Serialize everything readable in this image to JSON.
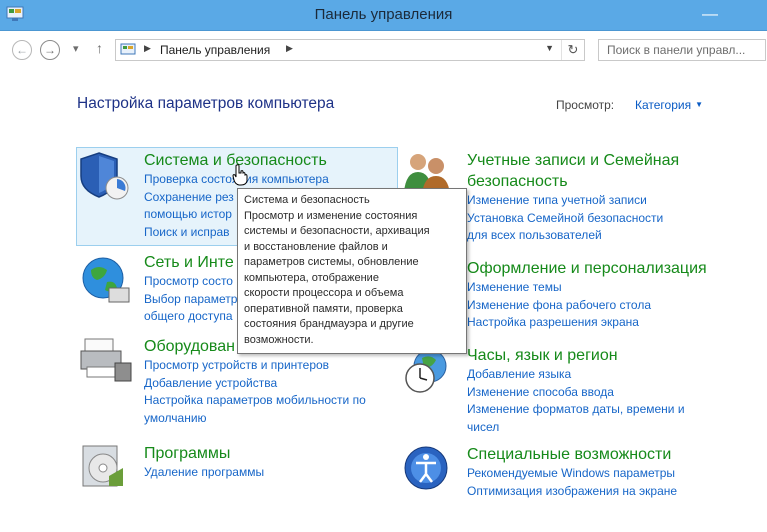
{
  "window": {
    "title": "Панель управления",
    "minimize": "—"
  },
  "nav": {
    "back": "←",
    "forward": "→",
    "recent": "▾",
    "up": "↑",
    "breadcrumb": "Панель управления",
    "search_placeholder": "Поиск в панели управл..."
  },
  "heading": "Настройка параметров компьютера",
  "view": {
    "label": "Просмотр:",
    "value": "Категория"
  },
  "categories": [
    {
      "title": "Система и безопасность",
      "links": [
        "Проверка состояния компьютера",
        "Сохранение рез",
        "помощью истор",
        "Поиск и исправ"
      ]
    },
    {
      "title": "Сеть и Инте",
      "links": [
        "Просмотр состо",
        "Выбор параметр",
        "общего доступа"
      ]
    },
    {
      "title": "Оборудован",
      "links": [
        "Просмотр устройств и принтеров",
        "Добавление устройства",
        "Настройка параметров мобильности по",
        "умолчанию"
      ]
    },
    {
      "title": "Программы",
      "links": [
        "Удаление программы"
      ]
    },
    {
      "title_lines": [
        "Учетные записи и Семейная",
        "безопасность"
      ],
      "links": [
        "Изменение типа учетной записи",
        "Установка Семейной безопасности",
        "для всех пользователей"
      ]
    },
    {
      "title": "Оформление и персонализация",
      "links": [
        "Изменение темы",
        "Изменение фона рабочего стола",
        "Настройка разрешения экрана"
      ]
    },
    {
      "title": "Часы, язык и регион",
      "links": [
        "Добавление языка",
        "Изменение способа ввода",
        "Изменение форматов даты, времени и",
        "чисел"
      ]
    },
    {
      "title": "Специальные возможности",
      "links": [
        "Рекомендуемые Windows параметры",
        "Оптимизация изображения на экране"
      ]
    }
  ],
  "tooltip": {
    "lines": [
      "Система и безопасность",
      "Просмотр и изменение состояния",
      "системы и безопасности, архивация",
      "и восстановление файлов и",
      "параметров системы, обновление",
      "компьютера, отображение",
      "скорости процессора и объема",
      "оперативной памяти, проверка",
      "состояния брандмауэра и другие",
      "возможности."
    ]
  },
  "colors": {
    "title_bar": "#5aa9e6",
    "category_title": "#168a1a",
    "link": "#1766c8",
    "heading": "#1e3287"
  }
}
